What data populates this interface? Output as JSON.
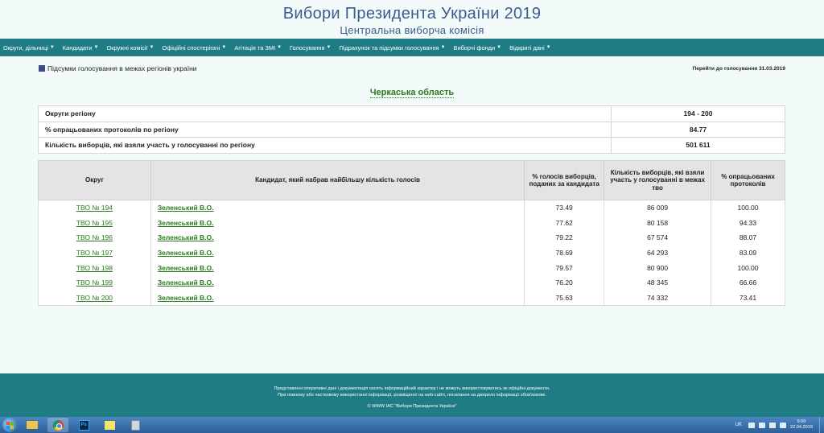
{
  "header": {
    "title": "Вибори Президента України 2019",
    "subtitle": "Центральна виборча комісія"
  },
  "nav": {
    "items": [
      "Округи, дільниці",
      "Кандидати",
      "Окружні комісії",
      "Офіційні спостерігачі",
      "Агітація та ЗМІ",
      "Голосування",
      "Підрахунок та підсумки голосування",
      "Виборчі фонди",
      "Відкриті дані"
    ]
  },
  "breadcrumb": "Підсумки голосування в межах регіонів україни",
  "goto_link": "Перейти до голосування 31.03.2019",
  "region": "Черкаська область",
  "summary": [
    {
      "label": "Округи регіону",
      "value": "194 - 200"
    },
    {
      "label": "% опрацьованих протоколів по регіону",
      "value": "84.77"
    },
    {
      "label": "Кількість виборців, які взяли участь у голосуванні по регіону",
      "value": "501 611"
    }
  ],
  "results": {
    "headers": {
      "okrug": "Округ",
      "candidate": "Кандидат, який набрав найбільшу кількість голосів",
      "pct_votes": "% голосів виборців, поданих за кандидата",
      "turnout": "Кількість виборців, які взяли участь у голосуванні в межах тво",
      "pct_protocols": "% опрацьованих протоколів"
    },
    "rows": [
      {
        "okrug": "ТВО № 194",
        "candidate": "Зеленський В.О.",
        "pct_votes": "73.49",
        "turnout": "86 009",
        "pct_protocols": "100.00"
      },
      {
        "okrug": "ТВО № 195",
        "candidate": "Зеленський В.О.",
        "pct_votes": "77.62",
        "turnout": "80 158",
        "pct_protocols": "94.33"
      },
      {
        "okrug": "ТВО № 196",
        "candidate": "Зеленський В.О.",
        "pct_votes": "79.22",
        "turnout": "67 574",
        "pct_protocols": "88.07"
      },
      {
        "okrug": "ТВО № 197",
        "candidate": "Зеленський В.О.",
        "pct_votes": "78.69",
        "turnout": "64 293",
        "pct_protocols": "83.09"
      },
      {
        "okrug": "ТВО № 198",
        "candidate": "Зеленський В.О.",
        "pct_votes": "79.57",
        "turnout": "80 900",
        "pct_protocols": "100.00"
      },
      {
        "okrug": "ТВО № 199",
        "candidate": "Зеленський В.О.",
        "pct_votes": "76.20",
        "turnout": "48 345",
        "pct_protocols": "66.66"
      },
      {
        "okrug": "ТВО № 200",
        "candidate": "Зеленський В.О.",
        "pct_votes": "75.63",
        "turnout": "74 332",
        "pct_protocols": "73.41"
      }
    ]
  },
  "footer": {
    "line1": "Представлені оперативні дані і документація носять інформаційний характер і не можуть використовуватись як офіційні документи.",
    "line2": "При повному або частковому використанні інформації, розміщеної на web-сайті, посилання на джерело інформації обов'язкове.",
    "copyright": "© WWW ІАС \"Вибори Президента України\""
  },
  "taskbar": {
    "apps": [
      "folder-icon",
      "chrome-icon",
      "photoshop-icon",
      "sticky-notes-icon",
      "calculator-icon"
    ],
    "ps_label": "Ps",
    "lang": "UK",
    "time": "9:00",
    "date": "22.04.2019"
  },
  "colors": {
    "nav_bg": "#1f7c85",
    "title": "#3e5b8e",
    "link_green": "#2a7a1e",
    "header_row_bg": "#e4e4e4",
    "page_bg": "#f3fafa"
  }
}
